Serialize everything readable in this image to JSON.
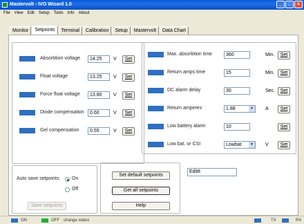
{
  "window": {
    "title": "Mastervolt - IVO Wizard 1.0",
    "min": "_",
    "max": "□",
    "close": "×"
  },
  "menu": [
    "File",
    "View",
    "Edit",
    "Setup",
    "Tools",
    "Info",
    "About"
  ],
  "tabs": [
    "Monitor",
    "Setpoints",
    "Terminal",
    "Calibration",
    "Setup",
    "Mastervolt",
    "Data Chart"
  ],
  "left_settings": [
    {
      "label": "Absorbtion voltage",
      "value": "14.25",
      "unit": "V",
      "button": "Set"
    },
    {
      "label": "Float voltage",
      "value": "13.25",
      "unit": "V",
      "button": "Set"
    },
    {
      "label": "Force float voltage",
      "value": "13.80",
      "unit": "V",
      "button": "Set"
    },
    {
      "label": "Diode compensation",
      "value": "0.60",
      "unit": "V",
      "button": "Set"
    },
    {
      "label": "Gel compensation",
      "value": "0.55",
      "unit": "V",
      "button": "Set"
    }
  ],
  "right_settings": [
    {
      "label": "Max. absorbtion time",
      "value": "360",
      "unit": "Min.",
      "button": "Set"
    },
    {
      "label": "Return amps time",
      "value": "15",
      "unit": "Min.",
      "button": "Set"
    },
    {
      "label": "DC alarm delay",
      "value": "30",
      "unit": "Sec.",
      "button": "Set"
    },
    {
      "label": "Return amperes",
      "value": "1.88",
      "unit": "A",
      "button": "Set"
    },
    {
      "label": "Low battery alarm",
      "value": "10",
      "unit": "",
      "button": "Set"
    },
    {
      "label": "Low bat. or CSI",
      "value": "Lowbat",
      "unit": "V",
      "button": "Set"
    }
  ],
  "auto_save": {
    "label": "Auto save setpoints:",
    "on": "On",
    "off": "Off",
    "save_button": "Save setpoints"
  },
  "actions": {
    "default": "Set default setpoints",
    "get_all": "Get all setpoints",
    "help": "Help"
  },
  "edit_field": "Edit8",
  "status": {
    "on": "ON",
    "off": "OFF",
    "change": "change status",
    "tx": "TX",
    "rx": "RX"
  },
  "colors": {
    "led_blue": "#2f6fc1",
    "led_green": "#1fae3a",
    "title_blue": "#0a5bd8"
  }
}
